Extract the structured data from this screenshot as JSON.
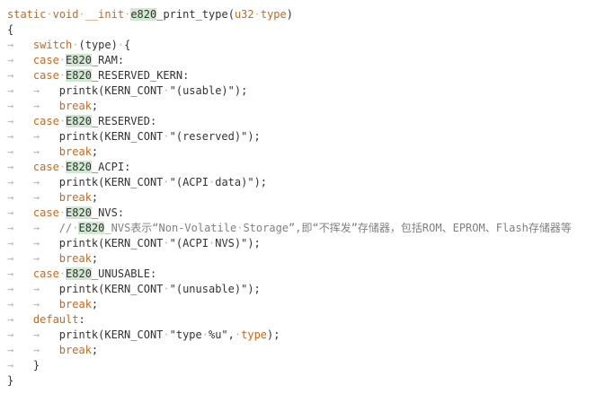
{
  "editor": {
    "lines": [
      [
        {
          "t": "static",
          "k": "kw"
        },
        {
          "t": "·",
          "k": "guide"
        },
        {
          "t": "void",
          "k": "kw"
        },
        {
          "t": "·",
          "k": "guide"
        },
        {
          "t": "__init",
          "k": "kw"
        },
        {
          "t": "·",
          "k": "guide"
        },
        {
          "t": "e820",
          "k": "hl"
        },
        {
          "t": "_print_type(",
          "k": "plain"
        },
        {
          "t": "u32",
          "k": "kw"
        },
        {
          "t": "·",
          "k": "guide"
        },
        {
          "t": "type",
          "k": "kw"
        },
        {
          "t": ")",
          "k": "plain"
        }
      ],
      [
        {
          "t": "{",
          "k": "plain"
        }
      ],
      [
        {
          "t": "→   ",
          "k": "guide"
        },
        {
          "t": "switch",
          "k": "kw"
        },
        {
          "t": "·",
          "k": "guide"
        },
        {
          "t": "(type)",
          "k": "plain"
        },
        {
          "t": "·",
          "k": "guide"
        },
        {
          "t": "{",
          "k": "plain"
        }
      ],
      [
        {
          "t": "→   ",
          "k": "guide"
        },
        {
          "t": "case",
          "k": "kw"
        },
        {
          "t": "·",
          "k": "guide"
        },
        {
          "t": "E820",
          "k": "hl"
        },
        {
          "t": "_RAM:",
          "k": "plain"
        }
      ],
      [
        {
          "t": "→   ",
          "k": "guide"
        },
        {
          "t": "case",
          "k": "kw"
        },
        {
          "t": "·",
          "k": "guide"
        },
        {
          "t": "E820",
          "k": "hl"
        },
        {
          "t": "_RESERVED_KERN:",
          "k": "plain"
        }
      ],
      [
        {
          "t": "→   →   ",
          "k": "guide"
        },
        {
          "t": "printk(KERN_CONT",
          "k": "plain"
        },
        {
          "t": "·",
          "k": "guide"
        },
        {
          "t": "\"(usable)\");",
          "k": "str"
        }
      ],
      [
        {
          "t": "→   →   ",
          "k": "guide"
        },
        {
          "t": "break",
          "k": "kw"
        },
        {
          "t": ";",
          "k": "plain"
        }
      ],
      [
        {
          "t": "→   ",
          "k": "guide"
        },
        {
          "t": "case",
          "k": "kw"
        },
        {
          "t": "·",
          "k": "guide"
        },
        {
          "t": "E820",
          "k": "hl"
        },
        {
          "t": "_RESERVED:",
          "k": "plain"
        }
      ],
      [
        {
          "t": "→   →   ",
          "k": "guide"
        },
        {
          "t": "printk(KERN_CONT",
          "k": "plain"
        },
        {
          "t": "·",
          "k": "guide"
        },
        {
          "t": "\"(reserved)\");",
          "k": "str"
        }
      ],
      [
        {
          "t": "→   →   ",
          "k": "guide"
        },
        {
          "t": "break",
          "k": "kw"
        },
        {
          "t": ";",
          "k": "plain"
        }
      ],
      [
        {
          "t": "→   ",
          "k": "guide"
        },
        {
          "t": "case",
          "k": "kw"
        },
        {
          "t": "·",
          "k": "guide"
        },
        {
          "t": "E820",
          "k": "hl"
        },
        {
          "t": "_ACPI:",
          "k": "plain"
        }
      ],
      [
        {
          "t": "→   →   ",
          "k": "guide"
        },
        {
          "t": "printk(KERN_CONT",
          "k": "plain"
        },
        {
          "t": "·",
          "k": "guide"
        },
        {
          "t": "\"(ACPI",
          "k": "str"
        },
        {
          "t": "·",
          "k": "guide"
        },
        {
          "t": "data)\");",
          "k": "str"
        }
      ],
      [
        {
          "t": "→   →   ",
          "k": "guide"
        },
        {
          "t": "break",
          "k": "kw"
        },
        {
          "t": ";",
          "k": "plain"
        }
      ],
      [
        {
          "t": "→   ",
          "k": "guide"
        },
        {
          "t": "case",
          "k": "kw"
        },
        {
          "t": "·",
          "k": "guide"
        },
        {
          "t": "E820",
          "k": "hl"
        },
        {
          "t": "_NVS:",
          "k": "plain"
        }
      ],
      [
        {
          "t": "→   →   ",
          "k": "guide"
        },
        {
          "t": "//",
          "k": "cm"
        },
        {
          "t": "·",
          "k": "guide"
        },
        {
          "t": "E820",
          "k": "hl"
        },
        {
          "t": "_NVS表示“Non-Volatile",
          "k": "cm"
        },
        {
          "t": "·",
          "k": "guide"
        },
        {
          "t": "Storage”,即“不挥发”存储器，包括ROM、EPROM、Flash存储器等",
          "k": "cm"
        }
      ],
      [
        {
          "t": "→   →   ",
          "k": "guide"
        },
        {
          "t": "printk(KERN_CONT",
          "k": "plain"
        },
        {
          "t": "·",
          "k": "guide"
        },
        {
          "t": "\"(ACPI",
          "k": "str"
        },
        {
          "t": "·",
          "k": "guide"
        },
        {
          "t": "NVS)\");",
          "k": "str"
        }
      ],
      [
        {
          "t": "→   →   ",
          "k": "guide"
        },
        {
          "t": "break",
          "k": "kw"
        },
        {
          "t": ";",
          "k": "plain"
        }
      ],
      [
        {
          "t": "→   ",
          "k": "guide"
        },
        {
          "t": "case",
          "k": "kw"
        },
        {
          "t": "·",
          "k": "guide"
        },
        {
          "t": "E820",
          "k": "hl"
        },
        {
          "t": "_UNUSABLE:",
          "k": "plain"
        }
      ],
      [
        {
          "t": "→   →   ",
          "k": "guide"
        },
        {
          "t": "printk(KERN_CONT",
          "k": "plain"
        },
        {
          "t": "·",
          "k": "guide"
        },
        {
          "t": "\"(unusable)\");",
          "k": "str"
        }
      ],
      [
        {
          "t": "→   →   ",
          "k": "guide"
        },
        {
          "t": "break",
          "k": "kw"
        },
        {
          "t": ";",
          "k": "plain"
        }
      ],
      [
        {
          "t": "→   ",
          "k": "guide"
        },
        {
          "t": "default",
          "k": "kw"
        },
        {
          "t": ":",
          "k": "plain"
        }
      ],
      [
        {
          "t": "→   →   ",
          "k": "guide"
        },
        {
          "t": "printk(KERN_CONT",
          "k": "plain"
        },
        {
          "t": "·",
          "k": "guide"
        },
        {
          "t": "\"type",
          "k": "str"
        },
        {
          "t": "·",
          "k": "guide"
        },
        {
          "t": "%u\",",
          "k": "str"
        },
        {
          "t": "·",
          "k": "guide"
        },
        {
          "t": "type",
          "k": "kw"
        },
        {
          "t": ");",
          "k": "plain"
        }
      ],
      [
        {
          "t": "→   →   ",
          "k": "guide"
        },
        {
          "t": "break",
          "k": "kw"
        },
        {
          "t": ";",
          "k": "plain"
        }
      ],
      [
        {
          "t": "→   ",
          "k": "guide"
        },
        {
          "t": "}",
          "k": "plain"
        }
      ],
      [
        {
          "t": "}",
          "k": "plain"
        }
      ]
    ],
    "colors": {
      "keyword": "#c9681d",
      "highlight": "#cfe8cf",
      "guide": "#b8b8b8",
      "text": "#333333"
    }
  }
}
